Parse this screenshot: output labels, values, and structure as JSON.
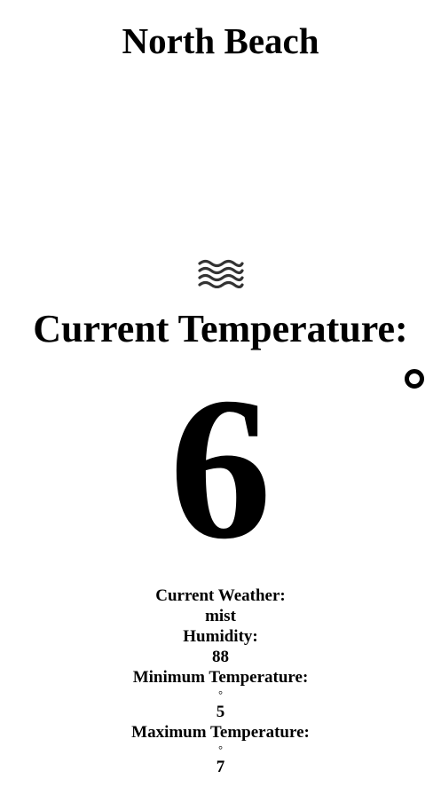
{
  "location": {
    "name": "North Beach"
  },
  "icon": {
    "name": "mist-icon"
  },
  "current": {
    "heading": "Current Temperature:",
    "temperature": "6",
    "degree_symbol": "°"
  },
  "details": {
    "weather_label": "Current Weather:",
    "weather_value": "mist",
    "humidity_label": "Humidity:",
    "humidity_value": "88",
    "min_label": "Minimum Temperature:",
    "min_degree": "°",
    "min_value": "5",
    "max_label": "Maximum Temperature:",
    "max_degree": "°",
    "max_value": "7"
  }
}
